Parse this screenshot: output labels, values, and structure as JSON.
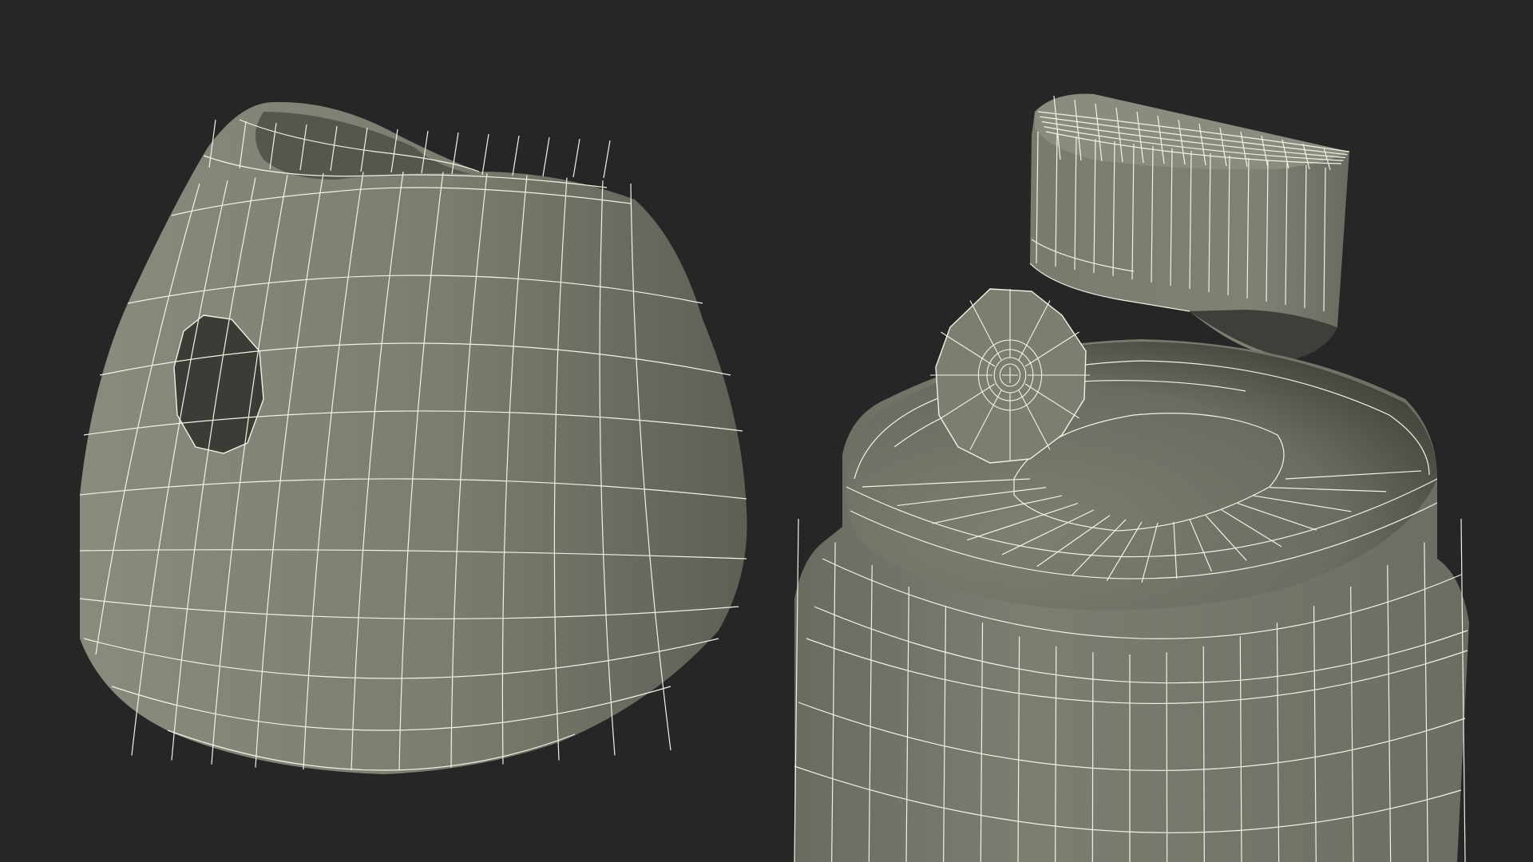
{
  "scene": {
    "background_color": "#262626",
    "surface_color": "#7b7c6f",
    "shadow_color": "#3a3b35",
    "wire_color": "#f2f2e6",
    "objects": [
      {
        "name": "spray-cap",
        "icon": "spray-cap-wireframe"
      },
      {
        "name": "nozzle-actuator",
        "icon": "nozzle-wireframe"
      },
      {
        "name": "nozzle-tip",
        "icon": "nozzle-tip-wireframe"
      },
      {
        "name": "spray-can-body",
        "icon": "can-body-wireframe"
      }
    ]
  }
}
